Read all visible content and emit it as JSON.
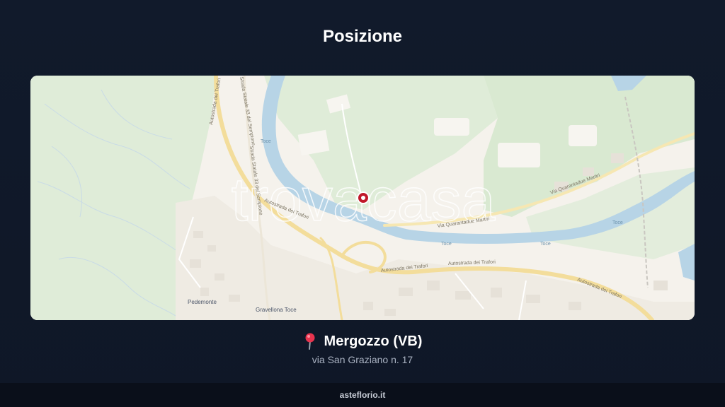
{
  "header": {
    "title": "Posizione"
  },
  "map": {
    "watermark": "trovacasa",
    "place_labels": [
      "Pedemonte",
      "Gravellona Toce"
    ],
    "road_labels": [
      "Autostrada dei Trafori",
      "Autostrada dei Trafori",
      "Autostrada dei Trafori",
      "Autostrada dei Trafori",
      "Autostrada dei Trafori",
      "Via Quarantadue Martiri",
      "Via Quarantadue Martiri",
      "Strada Statale 33 del Sempione",
      "Strada Statale 33 del Sempione"
    ],
    "water_labels": [
      "Toce",
      "Toce",
      "Toce",
      "Toce"
    ],
    "marker_color": "#c0182a"
  },
  "location": {
    "pin_icon": "round-pushpin-icon",
    "name": "Mergozzo (VB)",
    "address": "via San Graziano n. 17"
  },
  "footer": {
    "site": "asteflorio.it"
  }
}
